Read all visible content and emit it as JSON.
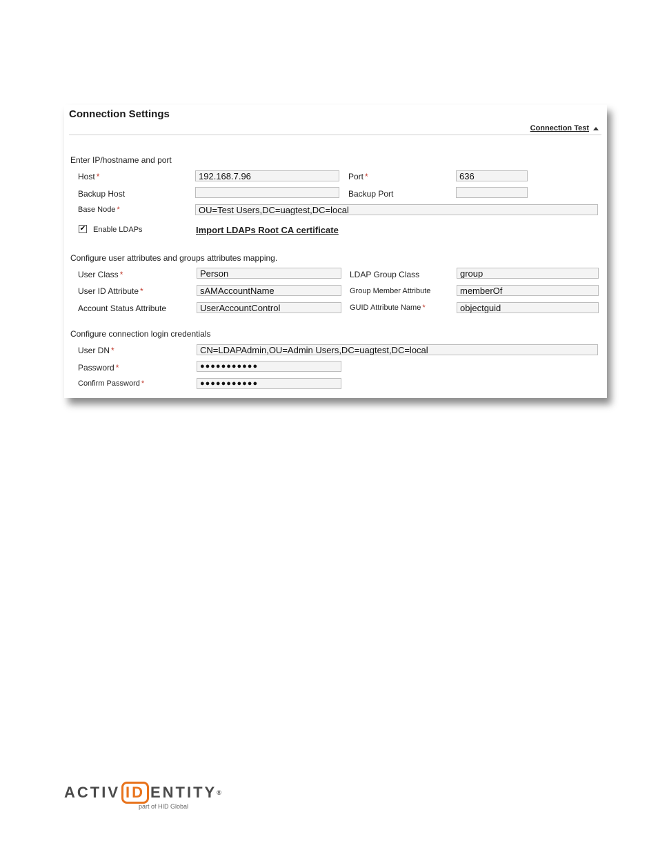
{
  "panel": {
    "title": "Connection Settings",
    "connection_test_label": "Connection Test"
  },
  "sections": {
    "ip": "Enter IP/hostname and port",
    "attributes": "Configure user attributes and groups attributes mapping.",
    "credentials": "Configure connection login credentials"
  },
  "required_mark": "*",
  "fields": {
    "host": {
      "label": "Host",
      "value": "192.168.7.96"
    },
    "port": {
      "label": "Port",
      "value": "636"
    },
    "backup_host": {
      "label": "Backup Host",
      "value": ""
    },
    "backup_port": {
      "label": "Backup Port",
      "value": ""
    },
    "base_node": {
      "label": "Base Node",
      "value": "OU=Test Users,DC=uagtest,DC=local"
    },
    "enable_ldaps": {
      "label": "Enable LDAPs",
      "checked": true,
      "check_glyph": "✔"
    },
    "import_cert_label": "Import LDAPs Root CA certificate",
    "user_class": {
      "label": "User Class",
      "value": "Person"
    },
    "ldap_group_class": {
      "label": "LDAP Group Class",
      "value": "group"
    },
    "user_id_attribute": {
      "label": "User ID Attribute",
      "value": "sAMAccountName"
    },
    "group_member_attribute": {
      "label": "Group Member Attribute",
      "value": "memberOf"
    },
    "account_status_attribute": {
      "label": "Account Status Attribute",
      "value": "UserAccountControl"
    },
    "guid_attribute_name": {
      "label": "GUID Attribute Name",
      "value": "objectguid"
    },
    "user_dn": {
      "label": "User DN",
      "value": "CN=LDAPAdmin,OU=Admin Users,DC=uagtest,DC=local"
    },
    "password": {
      "label": "Password",
      "value": "●●●●●●●●●●●"
    },
    "confirm_password": {
      "label": "Confirm Password",
      "value": "●●●●●●●●●●●"
    }
  },
  "logo": {
    "before": "ACTIV",
    "boxed": "ID",
    "after": "ENTITY",
    "registered": "®",
    "tagline": "part of HID Global",
    "accent_color": "#e8731c"
  }
}
